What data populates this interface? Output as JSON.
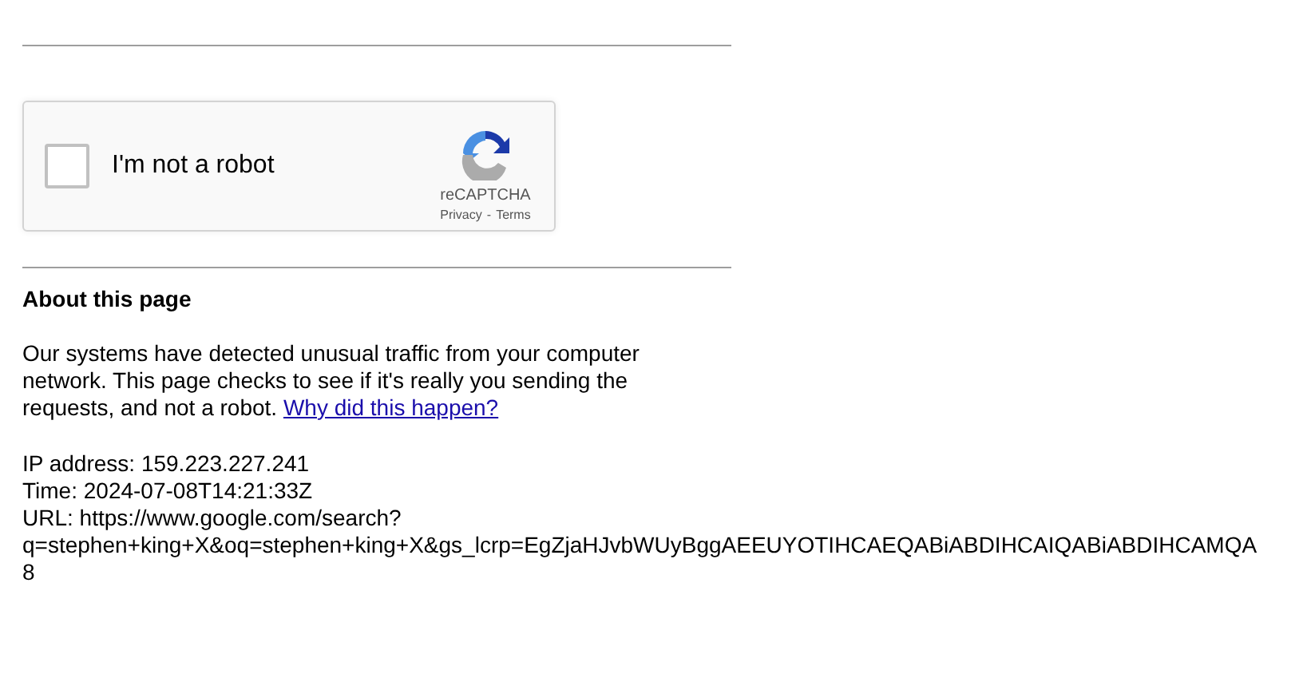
{
  "captcha": {
    "checked": false,
    "label": "I'm not a robot",
    "brand": "reCAPTCHA",
    "links": [
      "Privacy",
      "Terms"
    ],
    "separator": "-"
  },
  "about": {
    "heading": "About this page",
    "text": "Our systems have detected unusual traffic from your computer network. This page checks to see if it's really you sending the requests, and not a robot.",
    "link": "Why did this happen?"
  },
  "details": [
    "IP address: 159.223.227.241",
    "Time: 2024-07-08T14:21:33Z",
    "URL: https://www.google.com/search?",
    "q=stephen+king+X&oq=stephen+king+X&gs_lcrp=EgZjaHJvbWUyBggAEEUYOTIHCAEQABiABDIHCAIQABiABDIHCAMQA",
    "8"
  ]
}
